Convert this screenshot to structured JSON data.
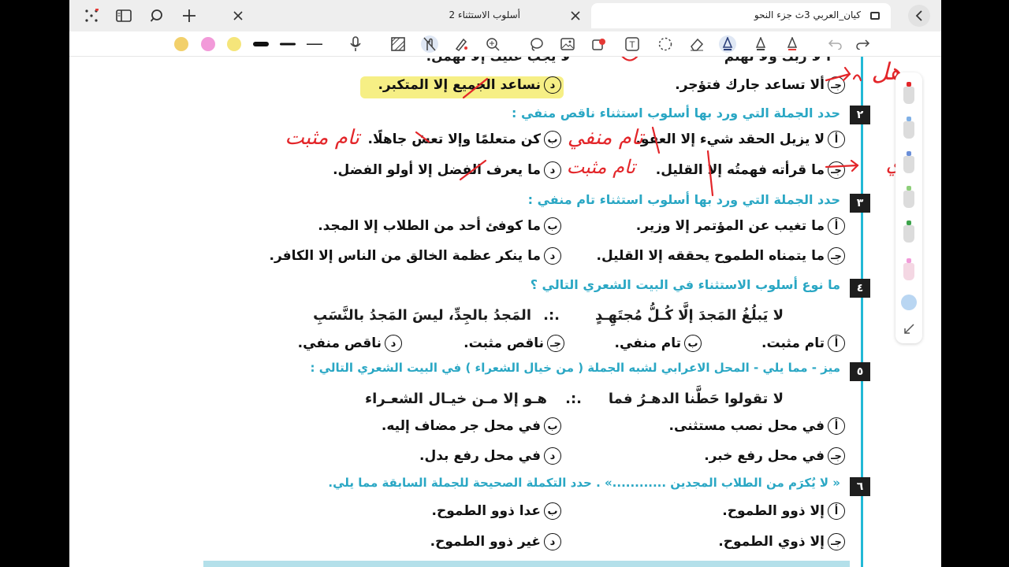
{
  "tabs": [
    {
      "label": "أسلوب الاستثناء 2",
      "active": false
    },
    {
      "label": "كيان_العربي 3ث جزء النحو",
      "active": true
    }
  ],
  "tabbar_icons": [
    "grid-dots-icon",
    "sidebar-icon",
    "search-icon",
    "plus-icon",
    "back-chevron-icon"
  ],
  "toolbar": {
    "swatches": [
      "#f2d06b",
      "#f29ad9",
      "#f5e57a"
    ],
    "icons": [
      "pen-thick-icon",
      "pen-medium-icon",
      "pen-thin-icon",
      "microphone-icon",
      "pattern-icon",
      "no-touch-icon",
      "highlighter-icon",
      "zoom-icon",
      "lasso-icon",
      "image-icon",
      "shape-icon",
      "text-box-icon",
      "selection-icon",
      "eraser-icon",
      "pen-tool-icon",
      "pencil-icon",
      "marker-icon",
      "undo-icon",
      "redo-icon"
    ]
  },
  "page": {
    "top_partial_right": "أ لا ربك ولا تهتم",
    "top_partial_left": "لا يجب عليك إلا تهمل.",
    "q1_options": {
      "j": "ألا تساعد جارك فتؤجر.",
      "d": "نساعد الجميع إلا المتكبر."
    },
    "q2": {
      "number": "٢",
      "prompt": "حدد الجملة التي ورد بها أسلوب استثناء ناقص منفي :",
      "a": "لا يزيل الحقد شيء إلا العفو.",
      "b": "كن متعلمًا وإلا تعش جاهلًا.",
      "j": "ما قرأته فهمتُه إلا القليل.",
      "d": "ما يعرف الفضل إلا أولو الفضل."
    },
    "q3": {
      "number": "٣",
      "prompt": "حدد الجملة التي ورد بها أسلوب استثناء تام منفي :",
      "a": "ما تغيب عن المؤتمر إلا وزير.",
      "b": "ما كوفئ أحد من الطلاب إلا المجد.",
      "j": "ما يتمناه الطموح يحققه إلا القليل.",
      "d": "ما ينكر عظمة الخالق من الناس إلا الكافر."
    },
    "q4": {
      "number": "٤",
      "prompt": "ما نوع أسلوب الاستثناء في البيت الشعري التالي ؟",
      "verse_right": "لا يَبلُغُ المَجدَ إلَّا كُـلُّ مُجتَهِـدٍ",
      "verse_sep": ".:.",
      "verse_left": "المَجدُ بالجِدِّ، ليسَ المَجدُ بالنَّسَبِ",
      "a": "تام مثبت.",
      "b": "تام منفي.",
      "j": "ناقص مثبت.",
      "d": "ناقص منفي."
    },
    "q5": {
      "number": "٥",
      "prompt": "ميز - مما يلي - المحل الاعرابي لشبه الجملة ( من خيال الشعراء ) في البيت الشعري التالي :",
      "verse_right": "لا تقولوا حَطَّنا الدهـرُ فما",
      "verse_sep": ".:.",
      "verse_left": "هـو إلا مـن خيـال الشعـراء",
      "a": "في محل نصب مستثنى.",
      "b": "في محل جر مضاف إليه.",
      "j": "في محل رفع خبر.",
      "d": "في محل رفع بدل."
    },
    "q6": {
      "number": "٦",
      "prompt": "« لا يُكرَم من الطلاب المجدين ............» . حدد التكملة الصحيحة للجملة السابقة مما يلي.",
      "a": "إلا ذوو الطموح.",
      "b": "عدا ذوو الطموح.",
      "j": "إلا ذوي الطموح.",
      "d": "غير ذوو الطموح."
    },
    "letters": {
      "a": "أ",
      "b": "ب",
      "j": "جـ",
      "d": "د"
    }
  },
  "handwriting": {
    "hal": "هل",
    "tam_munfi": "تام منفي",
    "tam_muthbat_1": "تام مثبت",
    "tam_muthbat_2": "تام مثبت",
    "ya": "ي"
  },
  "colors": {
    "accent_cyan": "#2aa7c4",
    "handwriting_red": "#e3262a",
    "highlight_yellow": "#f6ef85"
  }
}
